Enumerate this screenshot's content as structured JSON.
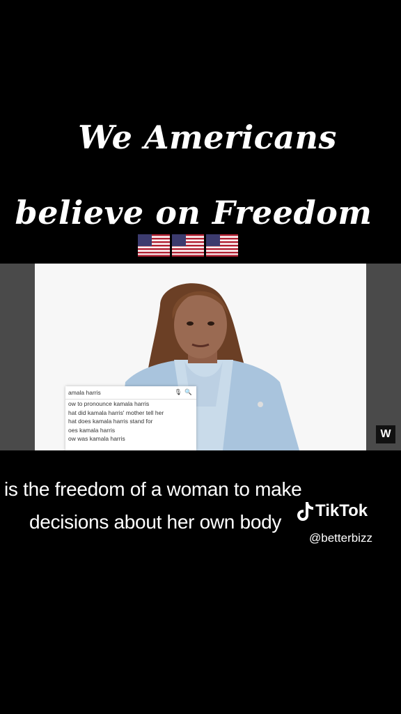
{
  "overlay": {
    "headline_line1": "We Americans",
    "headline_line2": "believe on Freedom"
  },
  "video": {
    "search_query": "amala harris",
    "suggestions": [
      "ow to pronounce kamala harris",
      "hat did kamala harris' mother tell her",
      "hat does kamala harris stand for",
      "oes kamala harris",
      "ow was kamala harris"
    ],
    "logo_text": "W"
  },
  "caption": {
    "line1": "is the freedom of a woman to make",
    "line2": "decisions about her own body"
  },
  "watermark": {
    "brand": "TikTok",
    "handle": "@betterbizz"
  },
  "colors": {
    "background": "#000000",
    "jacket": "#a9c4dd",
    "blouse": "#c9dbea",
    "hair": "#6b3f25",
    "skin": "#9a6a52"
  }
}
